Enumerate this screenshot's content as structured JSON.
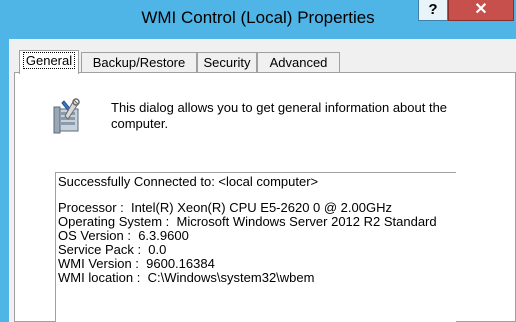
{
  "window": {
    "title": "WMI Control (Local) Properties",
    "help_label": "?",
    "close_label": "✕"
  },
  "tabs": [
    {
      "label": "General",
      "active": true
    },
    {
      "label": "Backup/Restore",
      "active": false
    },
    {
      "label": "Security",
      "active": false
    },
    {
      "label": "Advanced",
      "active": false
    }
  ],
  "general": {
    "description": "This dialog allows you to get general information about the computer.",
    "icon": "computer-tools-icon",
    "info": {
      "connected": "Successfully Connected to: <local computer>",
      "processor": "Processor :  Intel(R) Xeon(R) CPU E5-2620 0 @ 2.00GHz",
      "os": "Operating System :  Microsoft Windows Server 2012 R2 Standard",
      "os_version": "OS Version :  6.3.9600",
      "service_pack": "Service Pack :  0.0",
      "wmi_version": "WMI Version :  9600.16384",
      "wmi_location": "WMI location :  C:\\Windows\\system32\\wbem"
    }
  },
  "colors": {
    "titlebar": "#4fb4e6",
    "close_button": "#c7504c",
    "dialog_bg": "#f0f0f0"
  }
}
